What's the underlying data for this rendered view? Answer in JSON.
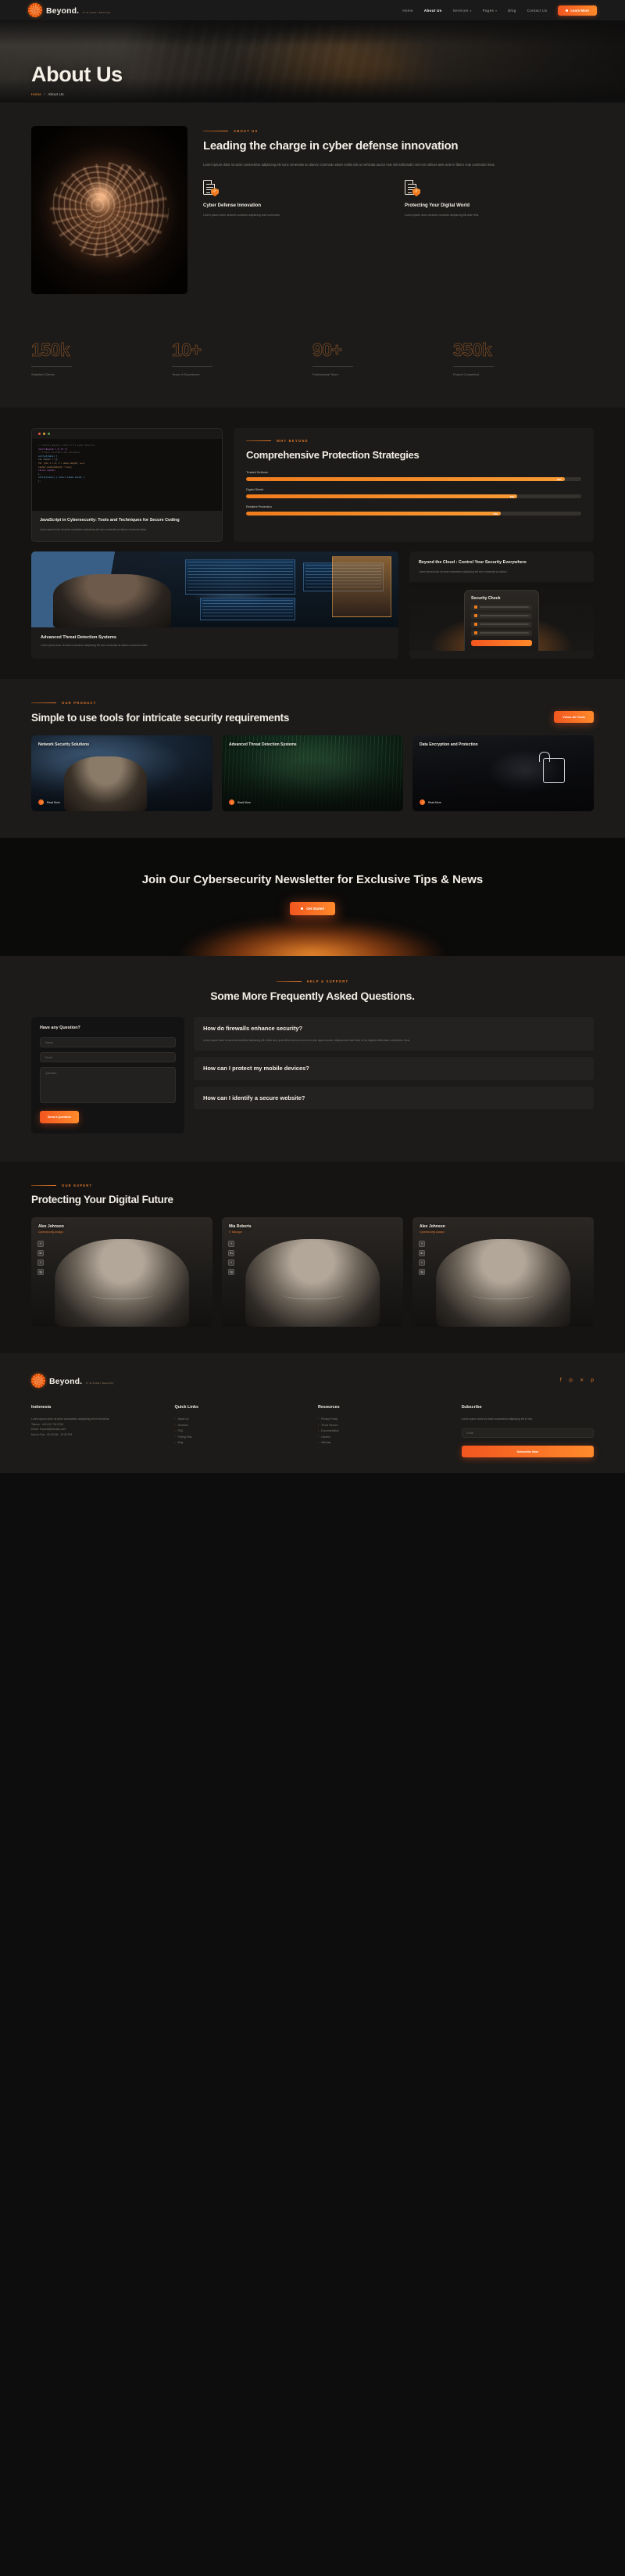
{
  "brand": {
    "name": "Beyond.",
    "tagline": "IT & Cyber Security"
  },
  "nav": {
    "items": [
      {
        "label": "Home",
        "active": false,
        "caret": false
      },
      {
        "label": "About Us",
        "active": true,
        "caret": false
      },
      {
        "label": "Services",
        "active": false,
        "caret": true
      },
      {
        "label": "Pages",
        "active": false,
        "caret": true
      },
      {
        "label": "Blog",
        "active": false,
        "caret": false
      },
      {
        "label": "Contact Us",
        "active": false,
        "caret": false
      }
    ],
    "cta": "Learn More"
  },
  "hero": {
    "title": "About Us",
    "crumb_home": "Home",
    "crumb_sep": "/",
    "crumb_current": "About Us"
  },
  "about": {
    "eyebrow": "ABOUT US",
    "title": "Leading the charge in cyber defense innovation",
    "paragraph": "Lorem ipsum dolor sit amet consectetur adipiscing elit nunc venenatis ac dianec commodo etiam mollis nisl ac vehicula auctor erat nisl sollicitudin nisi non ultrices ante ante in libero cras commodo risus.",
    "features": [
      {
        "title": "Cyber Defense Innovation",
        "text": "Lorem ipsum dolor sit amet consecte adipiscing sunt commodo."
      },
      {
        "title": "Protecting Your Digital World",
        "text": "Lorem ipsum dolor sit amet consecte adipiscing elit ante felis."
      }
    ]
  },
  "stats": [
    {
      "value": "150k",
      "label": "Statisfied Clients"
    },
    {
      "value": "10+",
      "label": "Years of Experience"
    },
    {
      "value": "90+",
      "label": "Professional Team"
    },
    {
      "value": "350k",
      "label": "Project Completed"
    }
  ],
  "why": {
    "eyebrow": "WHY BEYOND",
    "title": "Comprehensive Protection Strategies",
    "bars": [
      {
        "label": "Trusted Defense",
        "pct": "95%",
        "value": 95
      },
      {
        "label": "Digital Shield",
        "pct": "81%",
        "value": 81
      },
      {
        "label": "Resilient Protection",
        "pct": "76%",
        "value": 76
      }
    ],
    "code_card": {
      "title": "JavaScript in Cybersecurity: Tools and Techniques for Secure Coding",
      "text": "Lorem ipsum dolor sit amet consectetur adipiscing elit nunc venenatis ac dianec commodo etiam.",
      "lines": [
        "// Library Beyond + Mitre TT.4 Cyber Security",
        "const Beyond = {{ ch }}",
        "  // Create functions and variables",
        "  encrypt(data) {",
        "    let cipher = [];",
        "    for (let i = 0; i < data.length; i++)",
        "      cipher.push(data[i] ^ key);",
        "    return cipher;",
        "  },",
        "  verify(token) { return token.valid; }",
        "};"
      ]
    }
  },
  "duo": {
    "left": {
      "title": "Advanced Threat Detection Systems",
      "text": "Lorem ipsum dolor sit amet consectetur adipiscing elit nunc venenatis ac dianec commodo etiam."
    },
    "right": {
      "title": "Beyond the Cloud : Control Your Security Everywhere",
      "text": "Lorem ipsum dolor sit amet consectetur adipiscing elit nunc venenatis ac dianec.",
      "phone_title": "Security Check",
      "phone_cta": "Scan Now"
    }
  },
  "product": {
    "eyebrow": "OUR PRODUCT",
    "title": "Simple to use tools for intricate security requirements",
    "cta": "Views All Tools",
    "cards": [
      {
        "title": "Network Security Solutions",
        "link": "Read More"
      },
      {
        "title": "Advanced Threat Detection Systems",
        "link": "Read More"
      },
      {
        "title": "Data Encryption and Protection",
        "link": "Read More"
      }
    ]
  },
  "newsletter": {
    "title": "Join Our Cybersecurity Newsletter for Exclusive Tips & News",
    "cta": "Get Started"
  },
  "faq": {
    "eyebrow": "HELP & SUPPORT",
    "title": "Some More Frequently Asked Questions.",
    "form": {
      "heading": "Have any Question?",
      "name_placeholder": "Name",
      "email_placeholder": "Email",
      "question_placeholder": "Question",
      "submit": "Send a Question"
    },
    "items": [
      {
        "question": "How do firewalls enhance security?",
        "answer": "Lorem ipsum dolor sit amet consectetur adipiscing elit. Nulla nunc justo felis nisl nunc enim non arcu ligula consec. Aliquam sed odio dolor ut leo dapibus bibendum consectetur risus.",
        "open": true
      },
      {
        "question": "How can I protect my mobile devices?",
        "answer": "",
        "open": false
      },
      {
        "question": "How can I identify a secure website?",
        "answer": "",
        "open": false
      }
    ]
  },
  "team": {
    "eyebrow": "OUR EXPERT",
    "title": "Protecting Your Digital Future",
    "members": [
      {
        "name": "Alex Johnson",
        "role": "Cybersecurity Analyst"
      },
      {
        "name": "Mia Roberts",
        "role": "IT Manager"
      },
      {
        "name": "Alex Johnson",
        "role": "Cybersecurity Analyst"
      }
    ],
    "socials": [
      "f",
      "in",
      "t",
      "ig"
    ]
  },
  "footer": {
    "social": [
      "f",
      "ig",
      "t",
      "p"
    ],
    "address": {
      "heading": "Indonesia",
      "text": "Lorem ipsum dolor sit amet consectetur adipiscing elit et nisl tellus.",
      "phone_label": "Telkom : +62 812 734 6754",
      "email_label": "Email : beyond@domain.com",
      "hours": "Mon to Sun : 09.00 AM - 10.00 PM"
    },
    "quick_links": {
      "heading": "Quick Links",
      "items": [
        "About Us",
        "Services",
        "FAQ",
        "Pricing Plan",
        "Blog"
      ]
    },
    "resources": {
      "heading": "Resources",
      "items": [
        "Privacy Policy",
        "Terms Service",
        "Documentation",
        "Careers",
        "Sitemap"
      ]
    },
    "subscribe": {
      "heading": "Subscribe",
      "text": "Lorem ipsum dolor sit amet consectetur adipiscing elit et nisl.",
      "placeholder": "Email",
      "button": "Subscribe Now"
    }
  },
  "colors": {
    "accent": "#f2561f",
    "accent2": "#ff8a2b",
    "bg": "#1c1b19",
    "eyebrow": "#e0762b"
  }
}
